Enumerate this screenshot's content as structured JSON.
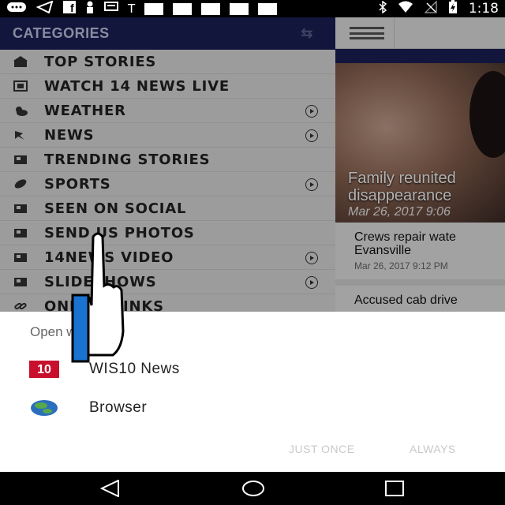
{
  "status_bar": {
    "left_icons": [
      "messaging-icon",
      "send-icon",
      "facebook-icon",
      "person-icon",
      "chat-icon",
      "text-icon",
      "notification-icon",
      "notification-icon",
      "notification-icon",
      "notification-icon",
      "notification-icon"
    ],
    "text_icon_glyph": "T",
    "time": "1:18",
    "right_icons": [
      "bluetooth-icon",
      "wifi-icon",
      "no-signal-icon",
      "battery-charging-icon"
    ]
  },
  "drawer": {
    "header": "CATEGORIES",
    "items": [
      {
        "label": "TOP STORIES",
        "icon": "home-news-icon",
        "has_arrow": false
      },
      {
        "label": "WATCH 14 NEWS LIVE",
        "icon": "video-icon",
        "has_arrow": false
      },
      {
        "label": "WEATHER",
        "icon": "weather-icon",
        "has_arrow": true
      },
      {
        "label": "NEWS",
        "icon": "news-icon",
        "has_arrow": true
      },
      {
        "label": "TRENDING STORIES",
        "icon": "newspaper-icon",
        "has_arrow": false
      },
      {
        "label": "SPORTS",
        "icon": "football-icon",
        "has_arrow": true
      },
      {
        "label": "SEEN ON SOCIAL",
        "icon": "newspaper-icon",
        "has_arrow": false
      },
      {
        "label": "SEND US PHOTOS",
        "icon": "newspaper-icon",
        "has_arrow": false
      },
      {
        "label": "14NEWS VIDEO",
        "icon": "newspaper-icon",
        "has_arrow": true
      },
      {
        "label": "SLIDESHOWS",
        "icon": "newspaper-icon",
        "has_arrow": true
      },
      {
        "label": "ONLINE LINKS",
        "icon": "link-icon",
        "has_arrow": false
      }
    ]
  },
  "feed": {
    "hero_title_line1": "Family reunited",
    "hero_title_line2": "disappearance",
    "hero_date": "Mar 26, 2017 9:06",
    "items": [
      {
        "title_line1": "Crews repair wate",
        "title_line2": "Evansville",
        "date": "Mar 26, 2017 9:12 PM"
      },
      {
        "title_line1": "Accused cab drive",
        "title_line2": "",
        "date": ""
      }
    ]
  },
  "chooser": {
    "title": "Open with",
    "options": [
      {
        "label": "WIS10 News",
        "icon": "wis10-news-icon"
      },
      {
        "label": "Browser",
        "icon": "browser-globe-icon"
      }
    ],
    "just_once": "JUST ONCE",
    "always": "ALWAYS",
    "wis10_logo_text": "10"
  },
  "colors": {
    "drawer_header": "#1b1f57",
    "accent_disabled": "#c9c9c9",
    "hand_blue": "#1a73d1"
  }
}
